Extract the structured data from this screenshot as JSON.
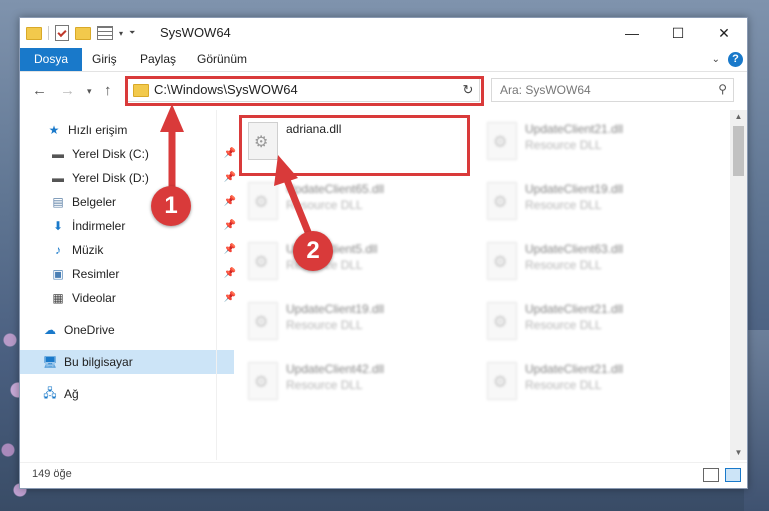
{
  "window": {
    "title": "SysWOW64",
    "controls": {
      "minimize": "—",
      "maximize": "☐",
      "close": "✕"
    }
  },
  "ribbon": {
    "tabs": [
      {
        "label": "Dosya",
        "active": true
      },
      {
        "label": "Giriş"
      },
      {
        "label": "Paylaş"
      },
      {
        "label": "Görünüm"
      }
    ],
    "help_label": "?",
    "accent_color": "#1979ca"
  },
  "address_bar": {
    "path": "C:\\Windows\\SysWOW64",
    "refresh_icon": "↻"
  },
  "search": {
    "placeholder": "Ara: SysWOW64",
    "icon": "⚲"
  },
  "sidebar": {
    "items": [
      {
        "label": "Hızlı erişim",
        "icon": "star-icon"
      },
      {
        "label": "Yerel Disk (C:)",
        "icon": "drive-icon",
        "pinned": true
      },
      {
        "label": "Yerel Disk (D:)",
        "icon": "drive-icon",
        "pinned": true
      },
      {
        "label": "Belgeler",
        "icon": "documents-icon",
        "pinned": true
      },
      {
        "label": "İndirmeler",
        "icon": "download-icon",
        "pinned": true
      },
      {
        "label": "Müzik",
        "icon": "music-icon",
        "pinned": true
      },
      {
        "label": "Resimler",
        "icon": "pictures-icon",
        "pinned": true
      },
      {
        "label": "Videolar",
        "icon": "videos-icon",
        "pinned": true
      },
      {
        "label": "OneDrive",
        "icon": "cloud-icon"
      },
      {
        "label": "Bu bilgisayar",
        "icon": "computer-icon",
        "selected": true
      },
      {
        "label": "Ağ",
        "icon": "network-icon"
      }
    ]
  },
  "files": [
    {
      "name": "adriana.dll",
      "type": "",
      "highlighted": true
    },
    {
      "name": "UpdateClient21.dll",
      "type": "Resource DLL"
    },
    {
      "name": "UpdateClient65.dll",
      "type": "Resource DLL"
    },
    {
      "name": "UpdateClient19.dll",
      "type": "Resource DLL"
    },
    {
      "name": "UpdateClient5.dll",
      "type": "Resource DLL"
    },
    {
      "name": "UpdateClient63.dll",
      "type": "Resource DLL"
    },
    {
      "name": "UpdateClient19.dll",
      "type": "Resource DLL"
    },
    {
      "name": "UpdateClient21.dll",
      "type": "Resource DLL"
    },
    {
      "name": "UpdateClient42.dll",
      "type": "Resource DLL"
    },
    {
      "name": "UpdateClient21.dll",
      "type": "Resource DLL"
    }
  ],
  "status": {
    "item_count": "149 öğe"
  },
  "annotations": {
    "marker_1": "1",
    "marker_2": "2",
    "highlight_color": "#d93a3a"
  }
}
